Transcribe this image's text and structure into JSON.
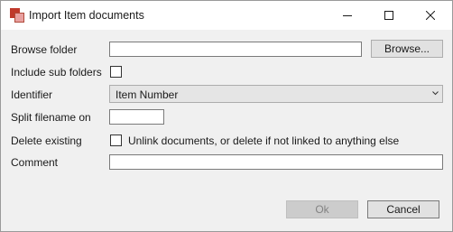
{
  "window": {
    "title": "Import Item documents",
    "icons": {
      "app": "app-icon",
      "minimize": "minimize-icon",
      "maximize": "maximize-icon",
      "close": "close-icon"
    }
  },
  "form": {
    "browse_folder": {
      "label": "Browse folder",
      "value": "",
      "button_label": "Browse..."
    },
    "include_sub_folders": {
      "label": "Include sub folders",
      "checked": false
    },
    "identifier": {
      "label": "Identifier",
      "selected": "Item Number"
    },
    "split_filename": {
      "label": "Split filename on",
      "value": ""
    },
    "delete_existing": {
      "label": "Delete existing",
      "checkbox_label": "Unlink documents, or delete if not linked to anything else",
      "checked": false
    },
    "comment": {
      "label": "Comment",
      "value": ""
    }
  },
  "buttons": {
    "ok": "Ok",
    "cancel": "Cancel"
  }
}
